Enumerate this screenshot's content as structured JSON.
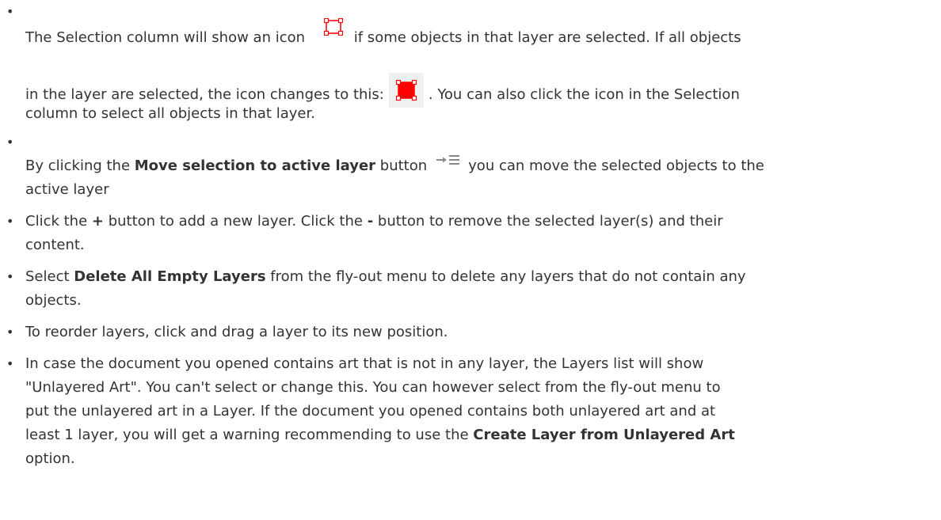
{
  "items": [
    {
      "lines": [
        [
          "The Selection column will show an icon ",
          "",
          "if some objects in that layer are selected. If all objects"
        ],
        [
          "in the layer are selected, the icon changes to this:",
          ". You can also click the icon in the Selection"
        ],
        [
          "column to select all objects in that layer."
        ]
      ]
    },
    {
      "lines": [
        [
          "By clicking the ",
          "Move selection to active layer",
          " button",
          "you can move the selected objects to the"
        ],
        [
          "active layer"
        ]
      ]
    },
    {
      "lines": [
        [
          "Click the ",
          "+",
          " button to add a new layer. Click the ",
          "-",
          " button to remove the selected layer(s) and their"
        ],
        [
          "content."
        ]
      ]
    },
    {
      "lines": [
        [
          "Select ",
          "Delete All Empty Layers",
          " from the fly-out menu to delete any layers that do not contain any"
        ],
        [
          "objects."
        ]
      ]
    },
    {
      "lines": [
        [
          "To reorder layers, click and drag a layer to its new position."
        ]
      ]
    },
    {
      "lines": [
        [
          "In case the document you opened contains art that is not in any layer, the Layers list will show"
        ],
        [
          "\"Unlayered Art\". You can't select or change this. You can however select from the fly-out menu to"
        ],
        [
          "put the unlayered art in a Layer. If the document you opened contains both unlayered art and at"
        ],
        [
          "least 1 layer, you will get a warning recommending to use the ",
          "Create Layer from Unlayered Art"
        ],
        [
          "option."
        ]
      ]
    }
  ],
  "icons": {
    "selection_partial": "selection-outline-icon",
    "selection_all": "selection-filled-icon",
    "move_to_layer": "move-selection-to-layer-icon",
    "accent": "#ff0000"
  }
}
